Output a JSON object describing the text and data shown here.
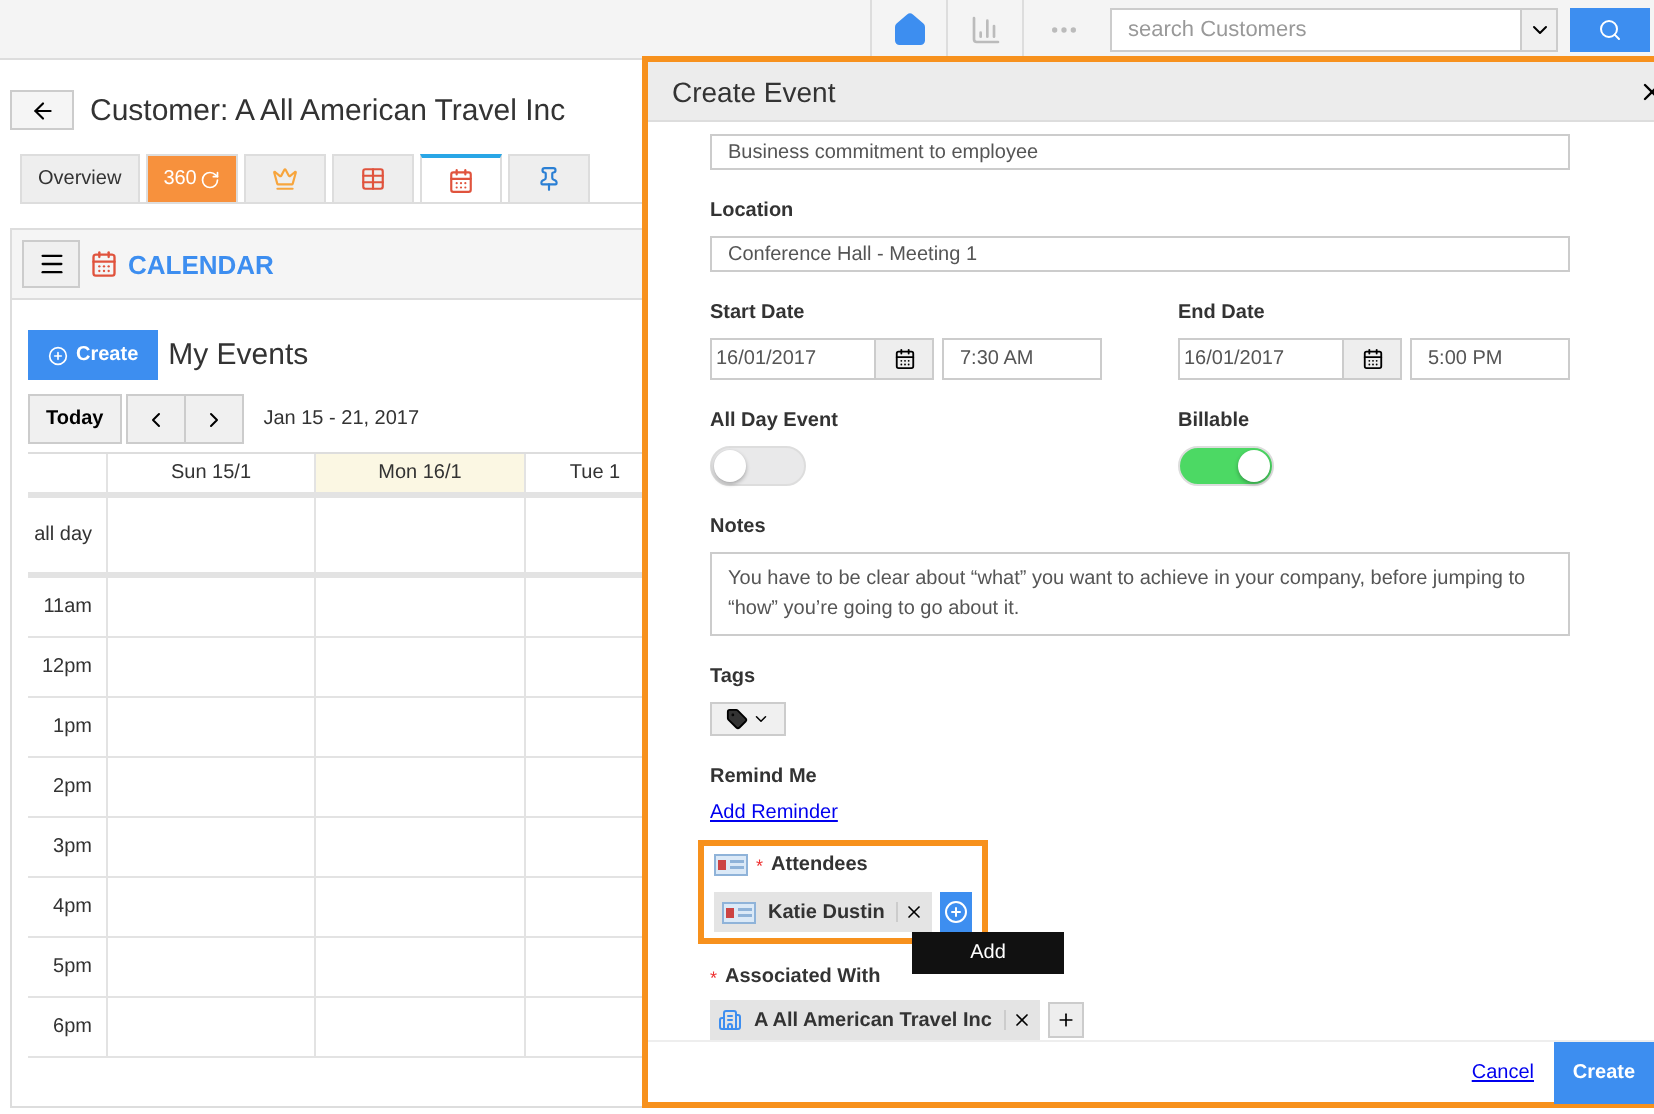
{
  "topbar": {
    "search": {
      "placeholder": "search Customers"
    }
  },
  "page": {
    "title": "Customer: A All American Travel Inc",
    "tabs": [
      {
        "kind": "text",
        "label": "Overview",
        "selected": false
      },
      {
        "kind": "counter",
        "label": "360",
        "selected": false
      },
      {
        "kind": "crown",
        "selected": false
      },
      {
        "kind": "table",
        "selected": false
      },
      {
        "kind": "calendar",
        "selected": true
      },
      {
        "kind": "pin",
        "selected": false
      }
    ]
  },
  "calendar": {
    "title": "CALENDAR",
    "create": "Create",
    "heading": "My Events",
    "today": "Today",
    "range": "Jan 15 - 21, 2017",
    "all_day": "all day",
    "columns": [
      {
        "label": "Sun 15/1",
        "today": false
      },
      {
        "label": "Mon 16/1",
        "today": true
      },
      {
        "label": "Tue 1",
        "today": false
      }
    ],
    "hours": [
      "11am",
      "12pm",
      "1pm",
      "2pm",
      "3pm",
      "4pm",
      "5pm",
      "6pm"
    ]
  },
  "dialog": {
    "title": "Create Event",
    "subject": "Business commitment to employee",
    "location": {
      "label": "Location",
      "value": "Conference Hall - Meeting 1"
    },
    "start": {
      "label": "Start Date",
      "date": "16/01/2017",
      "time": "7:30 AM"
    },
    "end": {
      "label": "End Date",
      "date": "16/01/2017",
      "time": "5:00 PM"
    },
    "all_day": {
      "label": "All Day Event",
      "on": false
    },
    "billable": {
      "label": "Billable",
      "on": true
    },
    "notes": {
      "label": "Notes",
      "value": "You have to be clear about “what” you want to achieve in your company, before jumping to “how” you’re going to go about it."
    },
    "tags": {
      "label": "Tags"
    },
    "remind": {
      "label": "Remind Me",
      "link": "Add Reminder"
    },
    "attendees": {
      "label": "Attendees",
      "required_mark": "*",
      "items": [
        {
          "name": "Katie Dustin"
        }
      ],
      "tooltip": "Add"
    },
    "associated": {
      "label": "Associated With",
      "required_mark": "*",
      "items": [
        {
          "name": "A All American Travel Inc"
        }
      ]
    },
    "cancel": "Cancel",
    "create": "Create"
  }
}
